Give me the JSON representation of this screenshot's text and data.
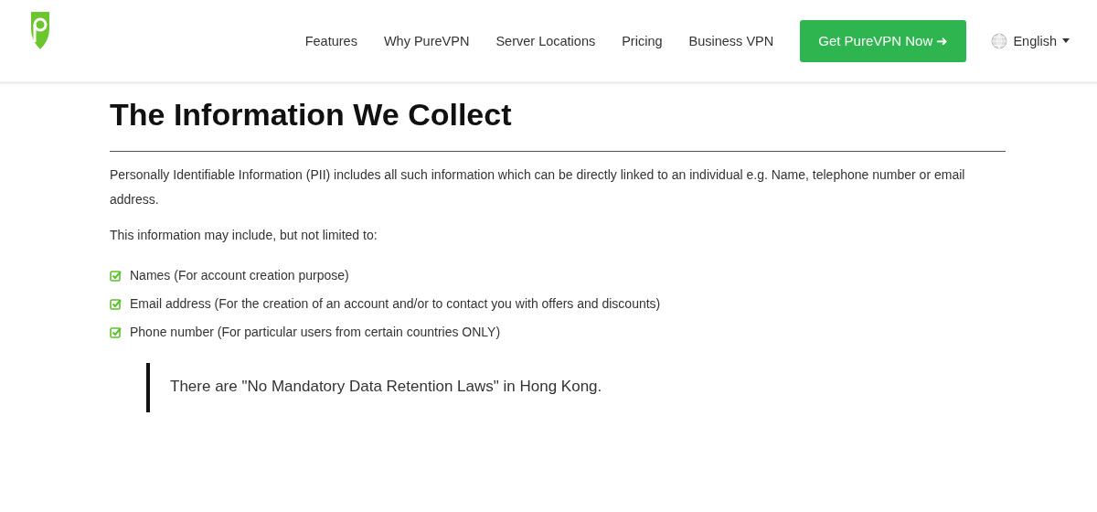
{
  "nav": {
    "links": [
      "Features",
      "Why PureVPN",
      "Server Locations",
      "Pricing",
      "Business VPN"
    ],
    "cta": "Get PureVPN Now ➜",
    "language": "English"
  },
  "content": {
    "title": "The Information We Collect",
    "paragraphs": [
      "Personally Identifiable Information (PII) includes all such information which can be directly linked to an individual e.g. Name, telephone number or email address.",
      "This information may include, but not limited to:"
    ],
    "list": [
      "Names (For account creation purpose)",
      "Email address (For the creation of an account and/or to contact you with offers and discounts)",
      "Phone number (For particular users from certain countries ONLY)"
    ],
    "quote": "There are \"No Mandatory Data Retention Laws\" in Hong Kong."
  }
}
